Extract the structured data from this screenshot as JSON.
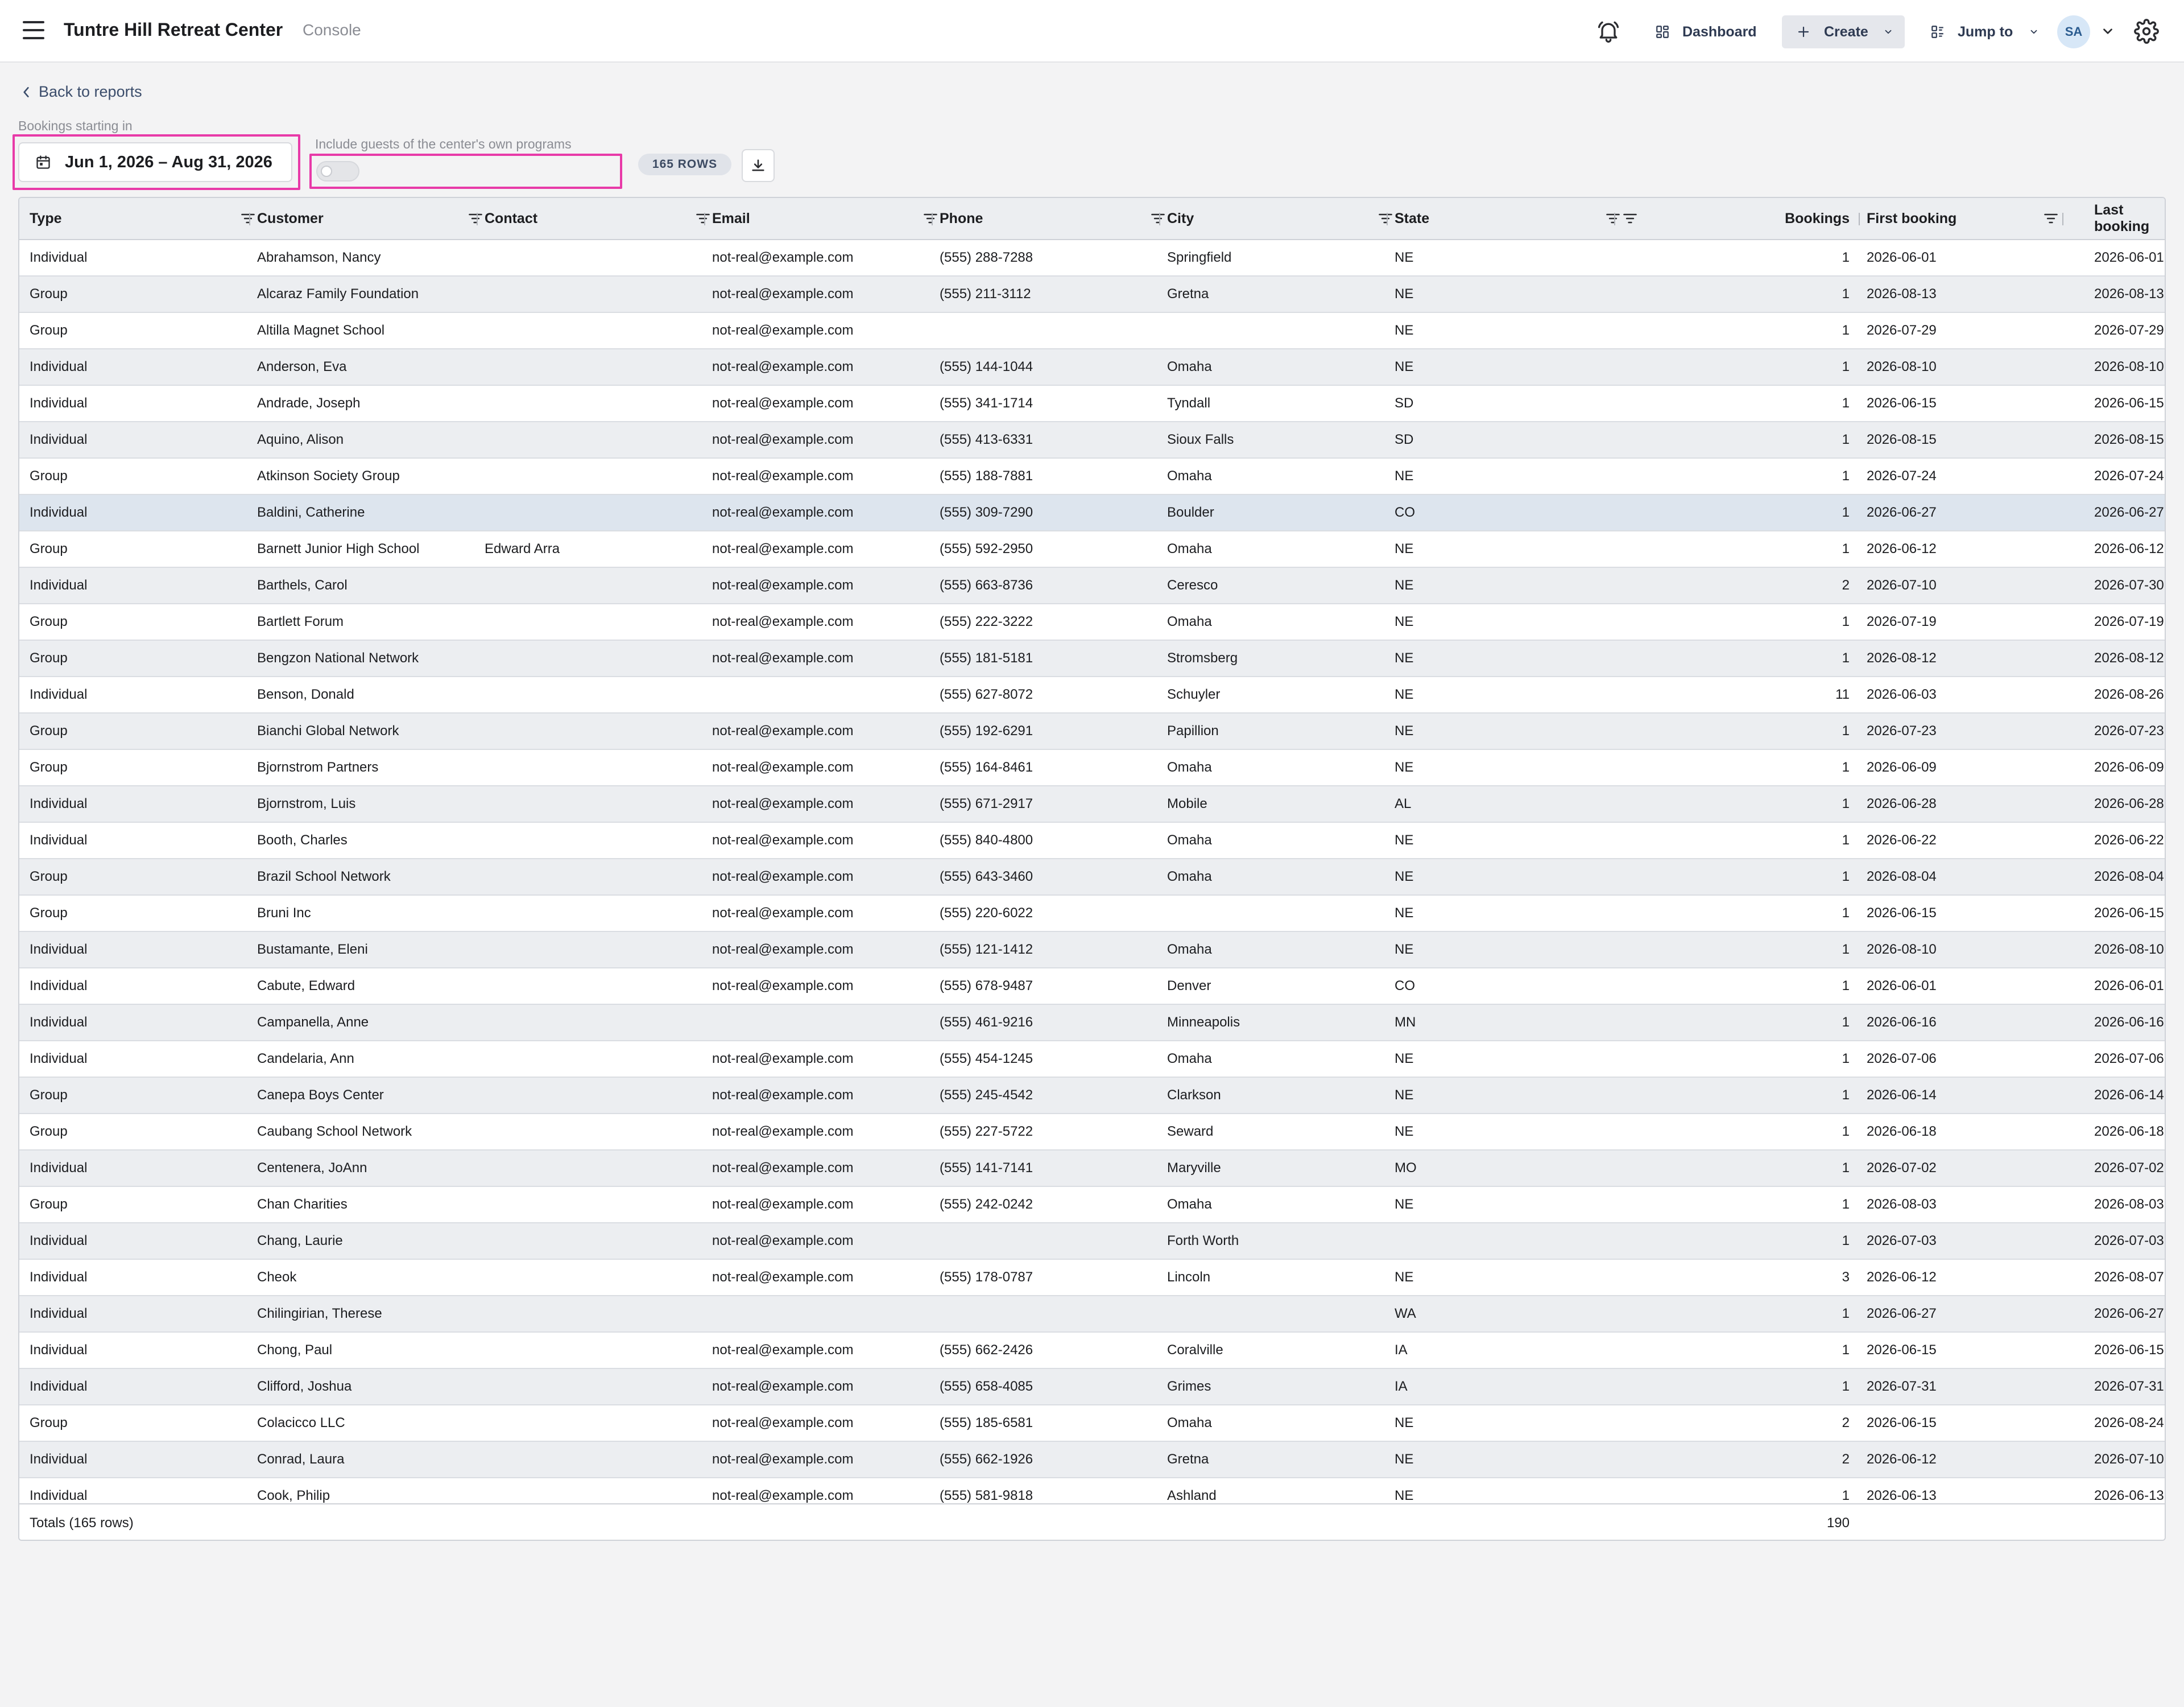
{
  "header": {
    "title": "Tuntre Hill Retreat Center",
    "subtitle": "Console",
    "dashboard_label": "Dashboard",
    "create_label": "Create",
    "jump_label": "Jump to",
    "avatar_initials": "SA"
  },
  "controls": {
    "back_label": "Back to reports",
    "bookings_label": "Bookings starting in",
    "date_range": "Jun 1, 2026 – Aug 31, 2026",
    "include_label": "Include guests of the center's own programs",
    "include_enabled": false,
    "rows_badge": "165 ROWS"
  },
  "table": {
    "columns": [
      "Type",
      "Customer",
      "Contact",
      "Email",
      "Phone",
      "City",
      "State",
      "",
      "Bookings",
      "First booking",
      "Last booking"
    ],
    "rows": [
      [
        "Individual",
        "Abrahamson, Nancy",
        "",
        "not-real@example.com",
        "(555) 288-7288",
        "Springfield",
        "NE",
        "1",
        "2026-06-01",
        "2026-06-01"
      ],
      [
        "Group",
        "Alcaraz Family Foundation",
        "",
        "not-real@example.com",
        "(555) 211-3112",
        "Gretna",
        "NE",
        "1",
        "2026-08-13",
        "2026-08-13"
      ],
      [
        "Group",
        "Altilla Magnet School",
        "",
        "not-real@example.com",
        "",
        "",
        "NE",
        "1",
        "2026-07-29",
        "2026-07-29"
      ],
      [
        "Individual",
        "Anderson, Eva",
        "",
        "not-real@example.com",
        "(555) 144-1044",
        "Omaha",
        "NE",
        "1",
        "2026-08-10",
        "2026-08-10"
      ],
      [
        "Individual",
        "Andrade, Joseph",
        "",
        "not-real@example.com",
        "(555) 341-1714",
        "Tyndall",
        "SD",
        "1",
        "2026-06-15",
        "2026-06-15"
      ],
      [
        "Individual",
        "Aquino, Alison",
        "",
        "not-real@example.com",
        "(555) 413-6331",
        "Sioux Falls",
        "SD",
        "1",
        "2026-08-15",
        "2026-08-15"
      ],
      [
        "Group",
        "Atkinson Society Group",
        "",
        "not-real@example.com",
        "(555) 188-7881",
        "Omaha",
        "NE",
        "1",
        "2026-07-24",
        "2026-07-24"
      ],
      [
        "Individual",
        "Baldini, Catherine",
        "",
        "not-real@example.com",
        "(555) 309-7290",
        "Boulder",
        "CO",
        "1",
        "2026-06-27",
        "2026-06-27"
      ],
      [
        "Group",
        "Barnett Junior High School",
        "Edward Arra",
        "not-real@example.com",
        "(555) 592-2950",
        "Omaha",
        "NE",
        "1",
        "2026-06-12",
        "2026-06-12"
      ],
      [
        "Individual",
        "Barthels, Carol",
        "",
        "not-real@example.com",
        "(555) 663-8736",
        "Ceresco",
        "NE",
        "2",
        "2026-07-10",
        "2026-07-30"
      ],
      [
        "Group",
        "Bartlett Forum",
        "",
        "not-real@example.com",
        "(555) 222-3222",
        "Omaha",
        "NE",
        "1",
        "2026-07-19",
        "2026-07-19"
      ],
      [
        "Group",
        "Bengzon National Network",
        "",
        "not-real@example.com",
        "(555) 181-5181",
        "Stromsberg",
        "NE",
        "1",
        "2026-08-12",
        "2026-08-12"
      ],
      [
        "Individual",
        "Benson, Donald",
        "",
        "",
        "(555) 627-8072",
        "Schuyler",
        "NE",
        "11",
        "2026-06-03",
        "2026-08-26"
      ],
      [
        "Group",
        "Bianchi Global Network",
        "",
        "not-real@example.com",
        "(555) 192-6291",
        "Papillion",
        "NE",
        "1",
        "2026-07-23",
        "2026-07-23"
      ],
      [
        "Group",
        "Bjornstrom Partners",
        "",
        "not-real@example.com",
        "(555) 164-8461",
        "Omaha",
        "NE",
        "1",
        "2026-06-09",
        "2026-06-09"
      ],
      [
        "Individual",
        "Bjornstrom, Luis",
        "",
        "not-real@example.com",
        "(555) 671-2917",
        "Mobile",
        "AL",
        "1",
        "2026-06-28",
        "2026-06-28"
      ],
      [
        "Individual",
        "Booth, Charles",
        "",
        "not-real@example.com",
        "(555) 840-4800",
        "Omaha",
        "NE",
        "1",
        "2026-06-22",
        "2026-06-22"
      ],
      [
        "Group",
        "Brazil School Network",
        "",
        "not-real@example.com",
        "(555) 643-3460",
        "Omaha",
        "NE",
        "1",
        "2026-08-04",
        "2026-08-04"
      ],
      [
        "Group",
        "Bruni Inc",
        "",
        "not-real@example.com",
        "(555) 220-6022",
        "",
        "NE",
        "1",
        "2026-06-15",
        "2026-06-15"
      ],
      [
        "Individual",
        "Bustamante, Eleni",
        "",
        "not-real@example.com",
        "(555) 121-1412",
        "Omaha",
        "NE",
        "1",
        "2026-08-10",
        "2026-08-10"
      ],
      [
        "Individual",
        "Cabute, Edward",
        "",
        "not-real@example.com",
        "(555) 678-9487",
        "Denver",
        "CO",
        "1",
        "2026-06-01",
        "2026-06-01"
      ],
      [
        "Individual",
        "Campanella, Anne",
        "",
        "",
        "(555) 461-9216",
        "Minneapolis",
        "MN",
        "1",
        "2026-06-16",
        "2026-06-16"
      ],
      [
        "Individual",
        "Candelaria, Ann",
        "",
        "not-real@example.com",
        "(555) 454-1245",
        "Omaha",
        "NE",
        "1",
        "2026-07-06",
        "2026-07-06"
      ],
      [
        "Group",
        "Canepa Boys Center",
        "",
        "not-real@example.com",
        "(555) 245-4542",
        "Clarkson",
        "NE",
        "1",
        "2026-06-14",
        "2026-06-14"
      ],
      [
        "Group",
        "Caubang School Network",
        "",
        "not-real@example.com",
        "(555) 227-5722",
        "Seward",
        "NE",
        "1",
        "2026-06-18",
        "2026-06-18"
      ],
      [
        "Individual",
        "Centenera, JoAnn",
        "",
        "not-real@example.com",
        "(555) 141-7141",
        "Maryville",
        "MO",
        "1",
        "2026-07-02",
        "2026-07-02"
      ],
      [
        "Group",
        "Chan Charities",
        "",
        "not-real@example.com",
        "(555) 242-0242",
        "Omaha",
        "NE",
        "1",
        "2026-08-03",
        "2026-08-03"
      ],
      [
        "Individual",
        "Chang, Laurie",
        "",
        "not-real@example.com",
        "",
        "Forth Worth",
        "",
        "1",
        "2026-07-03",
        "2026-07-03"
      ],
      [
        "Individual",
        "Cheok",
        "",
        "not-real@example.com",
        "(555) 178-0787",
        "Lincoln",
        "NE",
        "3",
        "2026-06-12",
        "2026-08-07"
      ],
      [
        "Individual",
        "Chilingirian, Therese",
        "",
        "",
        "",
        "",
        "WA",
        "1",
        "2026-06-27",
        "2026-06-27"
      ],
      [
        "Individual",
        "Chong, Paul",
        "",
        "not-real@example.com",
        "(555) 662-2426",
        "Coralville",
        "IA",
        "1",
        "2026-06-15",
        "2026-06-15"
      ],
      [
        "Individual",
        "Clifford, Joshua",
        "",
        "not-real@example.com",
        "(555) 658-4085",
        "Grimes",
        "IA",
        "1",
        "2026-07-31",
        "2026-07-31"
      ],
      [
        "Group",
        "Colacicco LLC",
        "",
        "not-real@example.com",
        "(555) 185-6581",
        "Omaha",
        "NE",
        "2",
        "2026-06-15",
        "2026-08-24"
      ],
      [
        "Individual",
        "Conrad, Laura",
        "",
        "not-real@example.com",
        "(555) 662-1926",
        "Gretna",
        "NE",
        "2",
        "2026-06-12",
        "2026-07-10"
      ],
      [
        "Individual",
        "Cook, Philip",
        "",
        "not-real@example.com",
        "(555) 581-9818",
        "Ashland",
        "NE",
        "1",
        "2026-06-13",
        "2026-06-13"
      ]
    ],
    "footer": {
      "totals_label": "Totals (165 rows)",
      "bookings_total": "190"
    }
  }
}
